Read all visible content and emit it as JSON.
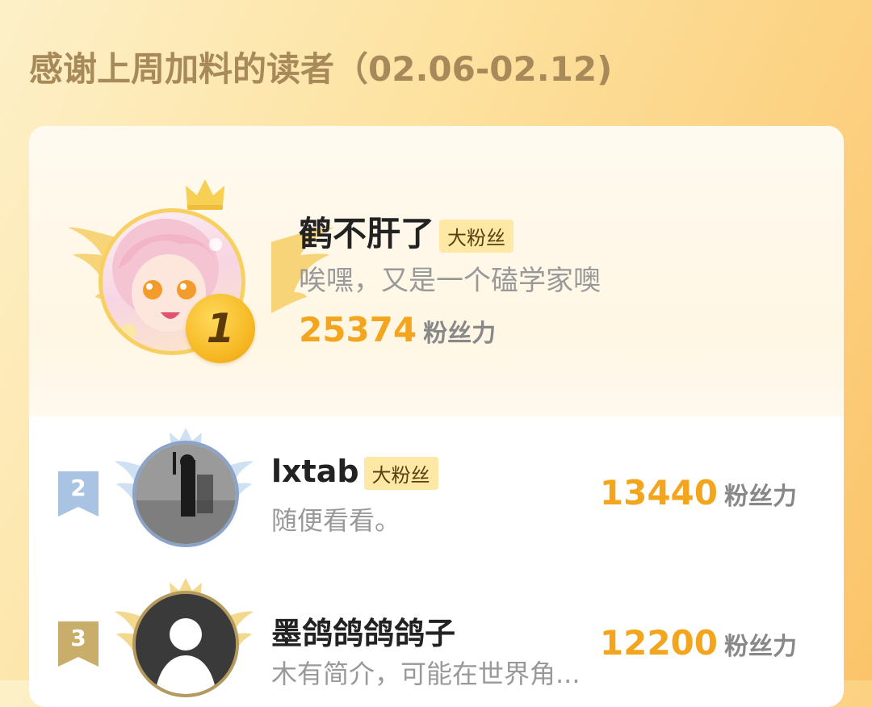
{
  "header": {
    "title": "感谢上周加料的读者（02.06-02.12)"
  },
  "ranking": [
    {
      "rank": "1",
      "name": "鹤不肝了",
      "tag": "大粉丝",
      "bio": "唉嘿，又是一个磕学家噢",
      "score": "25374",
      "unit": "粉丝力"
    },
    {
      "rank": "2",
      "name": "lxtab",
      "tag": "大粉丝",
      "bio": "随便看看。",
      "score": "13440",
      "unit": "粉丝力"
    },
    {
      "rank": "3",
      "name": "墨鸽鸽鸽鸽子",
      "tag": "",
      "bio": "木有简介，可能在世界角...",
      "score": "12200",
      "unit": "粉丝力"
    }
  ],
  "colors": {
    "accent": "#f2a51d",
    "gold": "#f6b722",
    "silver": "#a9c3e3",
    "bronze": "#c9ad6a"
  }
}
